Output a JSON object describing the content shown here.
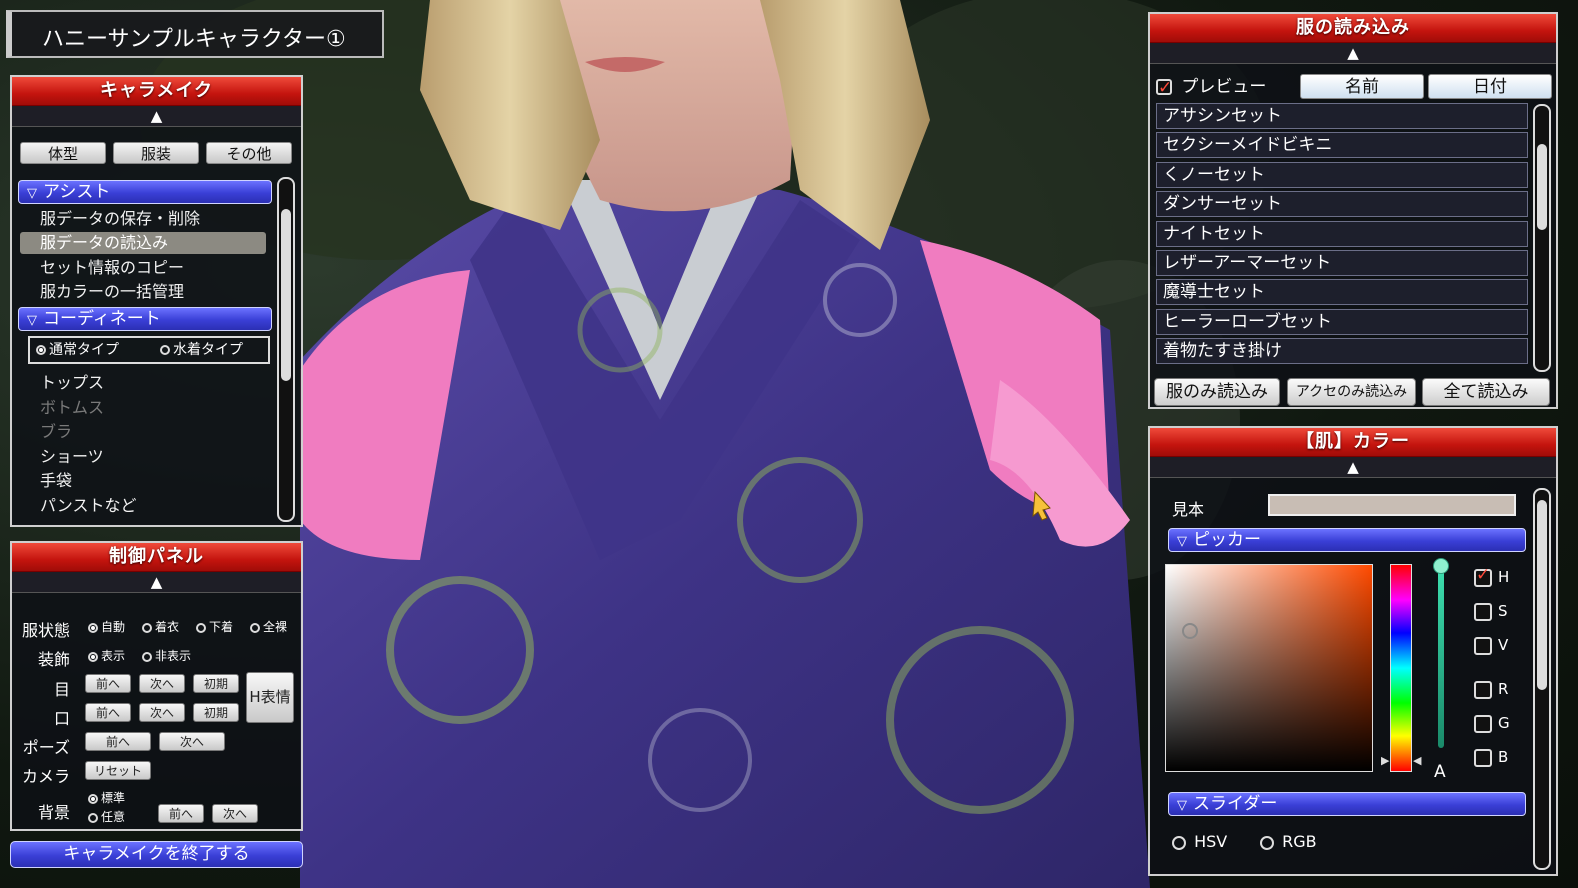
{
  "character_name": "ハニーサンプルキャラクター①",
  "charamake": {
    "title": "キャラメイク",
    "tabs": [
      "体型",
      "服装",
      "その他"
    ],
    "assist_header": "アシスト",
    "assist_items": [
      "服データの保存・削除",
      "服データの読込み",
      "セット情報のコピー",
      "服カラーの一括管理"
    ],
    "selected_item": "服データの読込み",
    "coordinate_header": "コーディネート",
    "coordinate_types": [
      "通常タイプ",
      "水着タイプ"
    ],
    "coordinate_items": [
      {
        "label": "トップス",
        "dim": false
      },
      {
        "label": "ボトムス",
        "dim": true
      },
      {
        "label": "ブラ",
        "dim": true
      },
      {
        "label": "ショーツ",
        "dim": false
      },
      {
        "label": "手袋",
        "dim": false
      },
      {
        "label": "パンストなど",
        "dim": false
      }
    ]
  },
  "control_panel": {
    "title": "制御パネル",
    "clothes_state_label": "服状態",
    "clothes_state_options": [
      "自動",
      "着衣",
      "下着",
      "全裸"
    ],
    "accessory_label": "装飾",
    "accessory_options": [
      "表示",
      "非表示"
    ],
    "eye_label": "目",
    "mouth_label": "口",
    "prev": "前へ",
    "next": "次へ",
    "initial": "初期",
    "h_expression": "H表情",
    "pose_label": "ポーズ",
    "camera_label": "カメラ",
    "reset": "リセット",
    "background_label": "背景",
    "background_options": [
      "標準",
      "任意"
    ]
  },
  "exit_button": "キャラメイクを終了する",
  "clothes_load": {
    "title": "服の読み込み",
    "preview_label": "プレビュー",
    "preview_checked": true,
    "sort_name": "名前",
    "sort_date": "日付",
    "items": [
      "アサシンセット",
      "セクシーメイドビキニ",
      "くノーセット",
      "ダンサーセット",
      "ナイトセット",
      "レザーアーマーセット",
      "魔導士セット",
      "ヒーラーローブセット",
      "着物たすき掛け"
    ],
    "load_clothes_only": "服のみ読込み",
    "load_accessories_only": "アクセのみ読込み",
    "load_all": "全て読込み"
  },
  "skin_color": {
    "title": "【肌】カラー",
    "sample_label": "見本",
    "sample_color": "#c8bdb4",
    "picker_header": "ピッカー",
    "channels_hsv": [
      "H",
      "S",
      "V"
    ],
    "channels_rgb": [
      "R",
      "G",
      "B"
    ],
    "checked_channel": "H",
    "alpha_label": "A",
    "slider_header": "スライダー",
    "mode_hsv": "HSV",
    "mode_rgb": "RGB"
  },
  "colors": {
    "accent_red": "#c4140e",
    "accent_blue": "#3a3fd6",
    "kimono_purple": "#4a3d8c",
    "ribbon_pink": "#f07cc0"
  }
}
